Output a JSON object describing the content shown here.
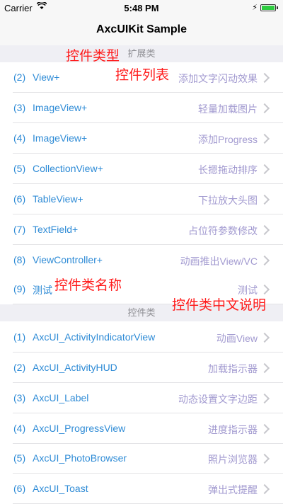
{
  "status_bar": {
    "carrier": "Carrier",
    "time": "5:48 PM",
    "battery_level": 1.0
  },
  "nav": {
    "title": "AxcUIKit Sample"
  },
  "sections": [
    {
      "header": "扩展类",
      "rows": [
        {
          "index": "(2)",
          "name": "View+",
          "desc": "添加文字闪动效果"
        },
        {
          "index": "(3)",
          "name": "ImageView+",
          "desc": "轻量加载图片"
        },
        {
          "index": "(4)",
          "name": "ImageView+",
          "desc": "添加Progress"
        },
        {
          "index": "(5)",
          "name": "CollectionView+",
          "desc": "长摁拖动排序"
        },
        {
          "index": "(6)",
          "name": "TableView+",
          "desc": "下拉放大头图"
        },
        {
          "index": "(7)",
          "name": "TextField+",
          "desc": "占位符参数修改"
        },
        {
          "index": "(8)",
          "name": "ViewController+",
          "desc": "动画推出View/VC"
        },
        {
          "index": "(9)",
          "name": "测试",
          "desc": "测试"
        }
      ]
    },
    {
      "header": "控件类",
      "rows": [
        {
          "index": "(1)",
          "name": "AxcUI_ActivityIndicatorView",
          "desc": "动画View"
        },
        {
          "index": "(2)",
          "name": "AxcUI_ActivityHUD",
          "desc": "加载指示器"
        },
        {
          "index": "(3)",
          "name": "AxcUI_Label",
          "desc": "动态设置文字边距"
        },
        {
          "index": "(4)",
          "name": "AxcUI_ProgressView",
          "desc": "进度指示器"
        },
        {
          "index": "(5)",
          "name": "AxcUI_PhotoBrowser",
          "desc": "照片浏览器"
        },
        {
          "index": "(6)",
          "name": "AxcUI_Toast",
          "desc": "弹出式提醒"
        }
      ]
    }
  ],
  "annotations": {
    "category_type": "控件类型",
    "control_list": "控件列表",
    "class_name": "控件类名称",
    "class_desc_cn": "控件类中文说明"
  },
  "colors": {
    "accent": "#2e8bd6",
    "detail": "#a29ad0",
    "annotation": "#ff1a1a",
    "section_bg": "#efeff4"
  }
}
